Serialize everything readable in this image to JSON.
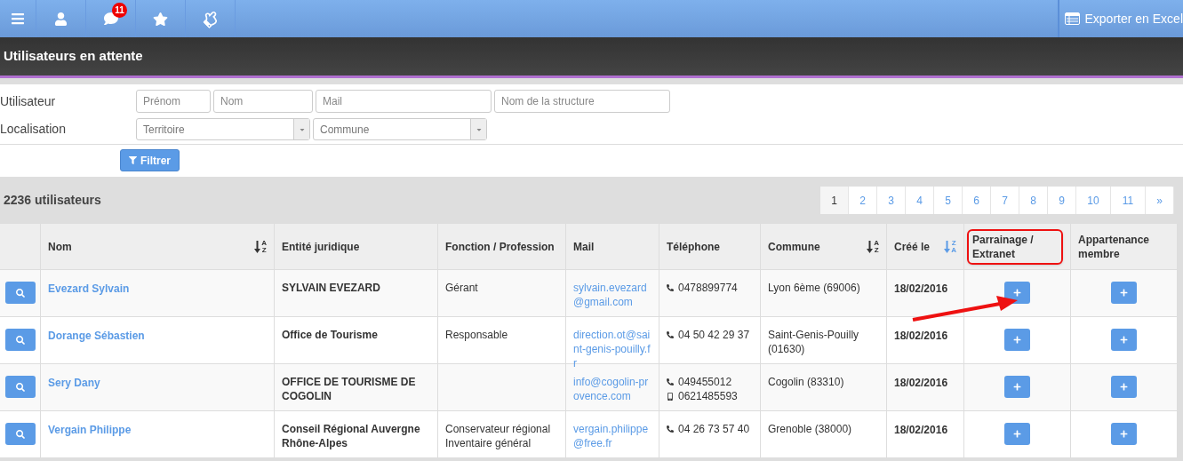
{
  "toolbar": {
    "items": [
      {
        "kind": "menu"
      },
      {
        "kind": "user"
      },
      {
        "kind": "messages",
        "badge": "11"
      },
      {
        "kind": "favorites"
      },
      {
        "kind": "like"
      }
    ],
    "export_button": "Exporter en Excel"
  },
  "page_title": "Utilisateurs en attente",
  "filters": {
    "rows": [
      {
        "label": "Utilisateur",
        "fields": [
          {
            "kind": "text",
            "placeholder": "Prénom"
          },
          {
            "kind": "text",
            "placeholder": "Nom"
          },
          {
            "kind": "text",
            "placeholder": "Mail"
          },
          {
            "kind": "text",
            "placeholder": "Nom de la structure"
          }
        ]
      },
      {
        "label": "Localisation",
        "fields": [
          {
            "kind": "select",
            "placeholder": "Territoire"
          },
          {
            "kind": "select",
            "placeholder": "Commune"
          }
        ]
      }
    ],
    "button": "Filtrer"
  },
  "count": "2236 utilisateurs",
  "pagination": [
    {
      "label": "1",
      "selected": true
    },
    {
      "label": "2",
      "selected": false
    },
    {
      "label": "3",
      "selected": false
    },
    {
      "label": "4",
      "selected": false
    },
    {
      "label": "5",
      "selected": false
    },
    {
      "label": "6",
      "selected": false
    },
    {
      "label": "7",
      "selected": false
    },
    {
      "label": "8",
      "selected": false
    },
    {
      "label": "9",
      "selected": false
    },
    {
      "label": "10",
      "selected": false
    },
    {
      "label": "11",
      "selected": false
    },
    {
      "label": "»",
      "selected": false
    }
  ],
  "table": {
    "columns": [
      {
        "label": "Nom",
        "sort": {
          "kind": "asc",
          "top": "A",
          "bottom": "Z"
        },
        "highlighted": false
      },
      {
        "label": "Entité juridique",
        "highlighted": false
      },
      {
        "label": "Fonction / Profession",
        "highlighted": false
      },
      {
        "label": "Mail",
        "highlighted": false
      },
      {
        "label": "Téléphone",
        "highlighted": false
      },
      {
        "label": "Commune",
        "sort": {
          "kind": "asc",
          "top": "A",
          "bottom": "Z"
        },
        "highlighted": false
      },
      {
        "label": "Créé le",
        "sort": {
          "kind": "desc",
          "top": "Z",
          "bottom": "A"
        },
        "highlighted": false
      },
      {
        "label": "Parrainage / Extranet",
        "highlighted": true
      },
      {
        "label": "Appartenance membre",
        "highlighted": false
      }
    ],
    "rows": [
      {
        "nom": "Evezard Sylvain",
        "entite": "SYLVAIN EVEZARD",
        "fonction": "Gérant",
        "mail": "sylvain.evezard@gmail.com",
        "phones": [
          {
            "kind": "phone",
            "number": "0478899774"
          }
        ],
        "commune": "Lyon 6ème (69006)",
        "cree": "18/02/2016"
      },
      {
        "nom": "Dorange Sébastien",
        "entite": "Office de Tourisme",
        "fonction": "Responsable",
        "mail": "direction.ot@saint-genis-pouilly.fr",
        "phones": [
          {
            "kind": "phone",
            "number": "04 50 42 29 37"
          }
        ],
        "commune": "Saint-Genis-Pouilly (01630)",
        "cree": "18/02/2016"
      },
      {
        "nom": "Sery Dany",
        "entite": "OFFICE DE TOURISME DE COGOLIN",
        "mail": "info@cogolin-provence.com",
        "phones": [
          {
            "kind": "phone",
            "number": "049455012"
          },
          {
            "kind": "mobile",
            "number": "0621485593"
          }
        ],
        "commune": "Cogolin (83310)",
        "cree": "18/02/2016"
      },
      {
        "nom": "Vergain Philippe",
        "entite": "Conseil Régional Auvergne Rhône-Alpes",
        "fonction": "Conservateur régional Inventaire général",
        "mail": "vergain.philippe@free.fr",
        "phones": [
          {
            "kind": "phone",
            "number": "04 26 73 57 40"
          }
        ],
        "commune": "Grenoble (38000)",
        "cree": "18/02/2016"
      }
    ]
  }
}
